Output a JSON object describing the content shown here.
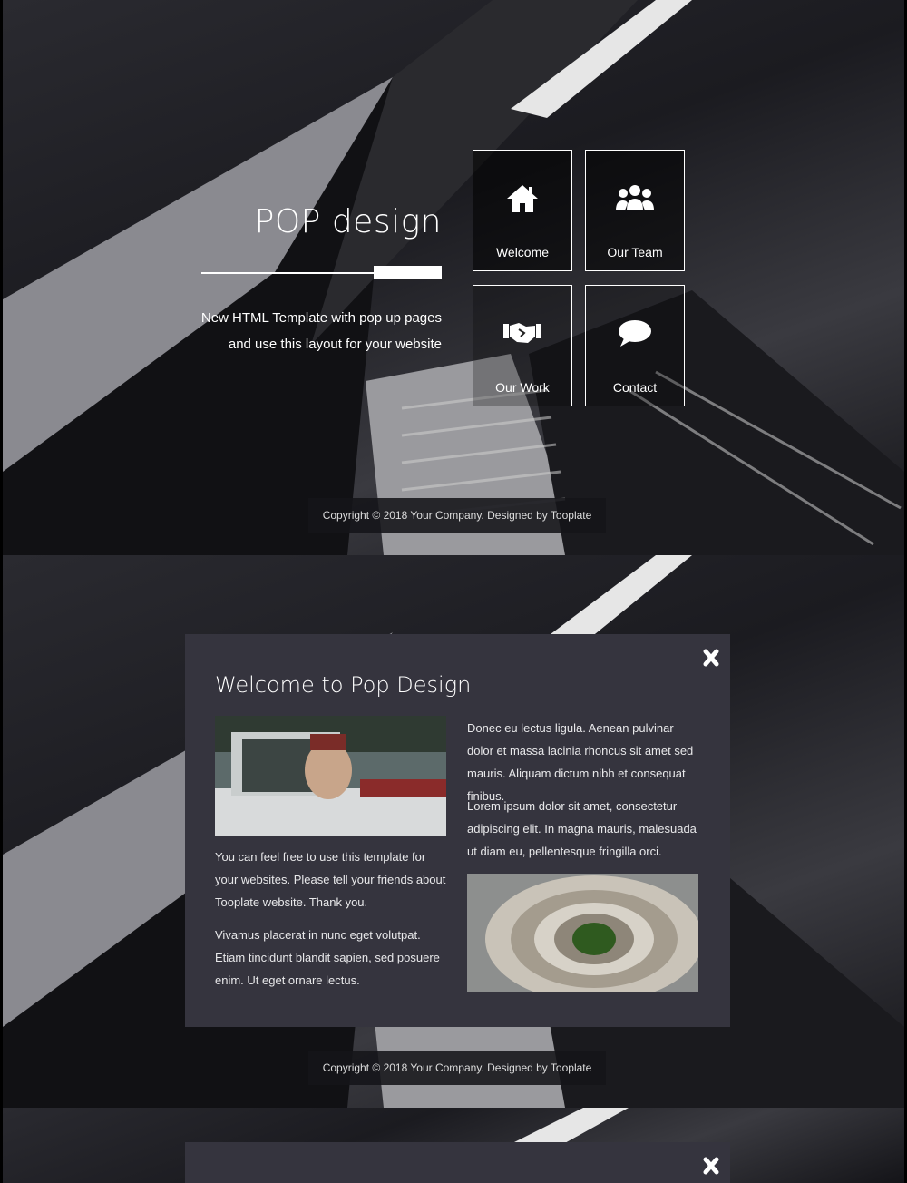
{
  "hero": {
    "title": "POP design",
    "tagline_line1": "New HTML Template with pop up pages",
    "tagline_line2": "and use this layout for your website"
  },
  "nav": [
    {
      "label": "Welcome",
      "icon": "home-icon"
    },
    {
      "label": "Our Team",
      "icon": "users-icon"
    },
    {
      "label": "Our Work",
      "icon": "handshake-icon"
    },
    {
      "label": "Contact",
      "icon": "chat-icon"
    }
  ],
  "footer": {
    "text": "Copyright © 2018 Your Company. Designed by Tooplate"
  },
  "modal": {
    "title": "Welcome to Pop Design",
    "left_para_1": "You can feel free to use this template for your websites. Please tell your friends about Tooplate website. Thank you.",
    "left_para_2": "Vivamus placerat in nunc eget volutpat. Etiam tincidunt blandit sapien, sed posuere enim. Ut eget ornare lectus.",
    "right_para_1": "Donec eu lectus ligula. Aenean pulvinar dolor et massa lacinia rhoncus sit amet sed mauris. Aliquam dictum nibh et consequat finibus.",
    "right_para_2": "Lorem ipsum dolor sit amet, consectetur adipiscing elit. In magna mauris, malesuada ut diam eu, pellentesque fringilla orci.",
    "close_icon": "close-icon"
  }
}
